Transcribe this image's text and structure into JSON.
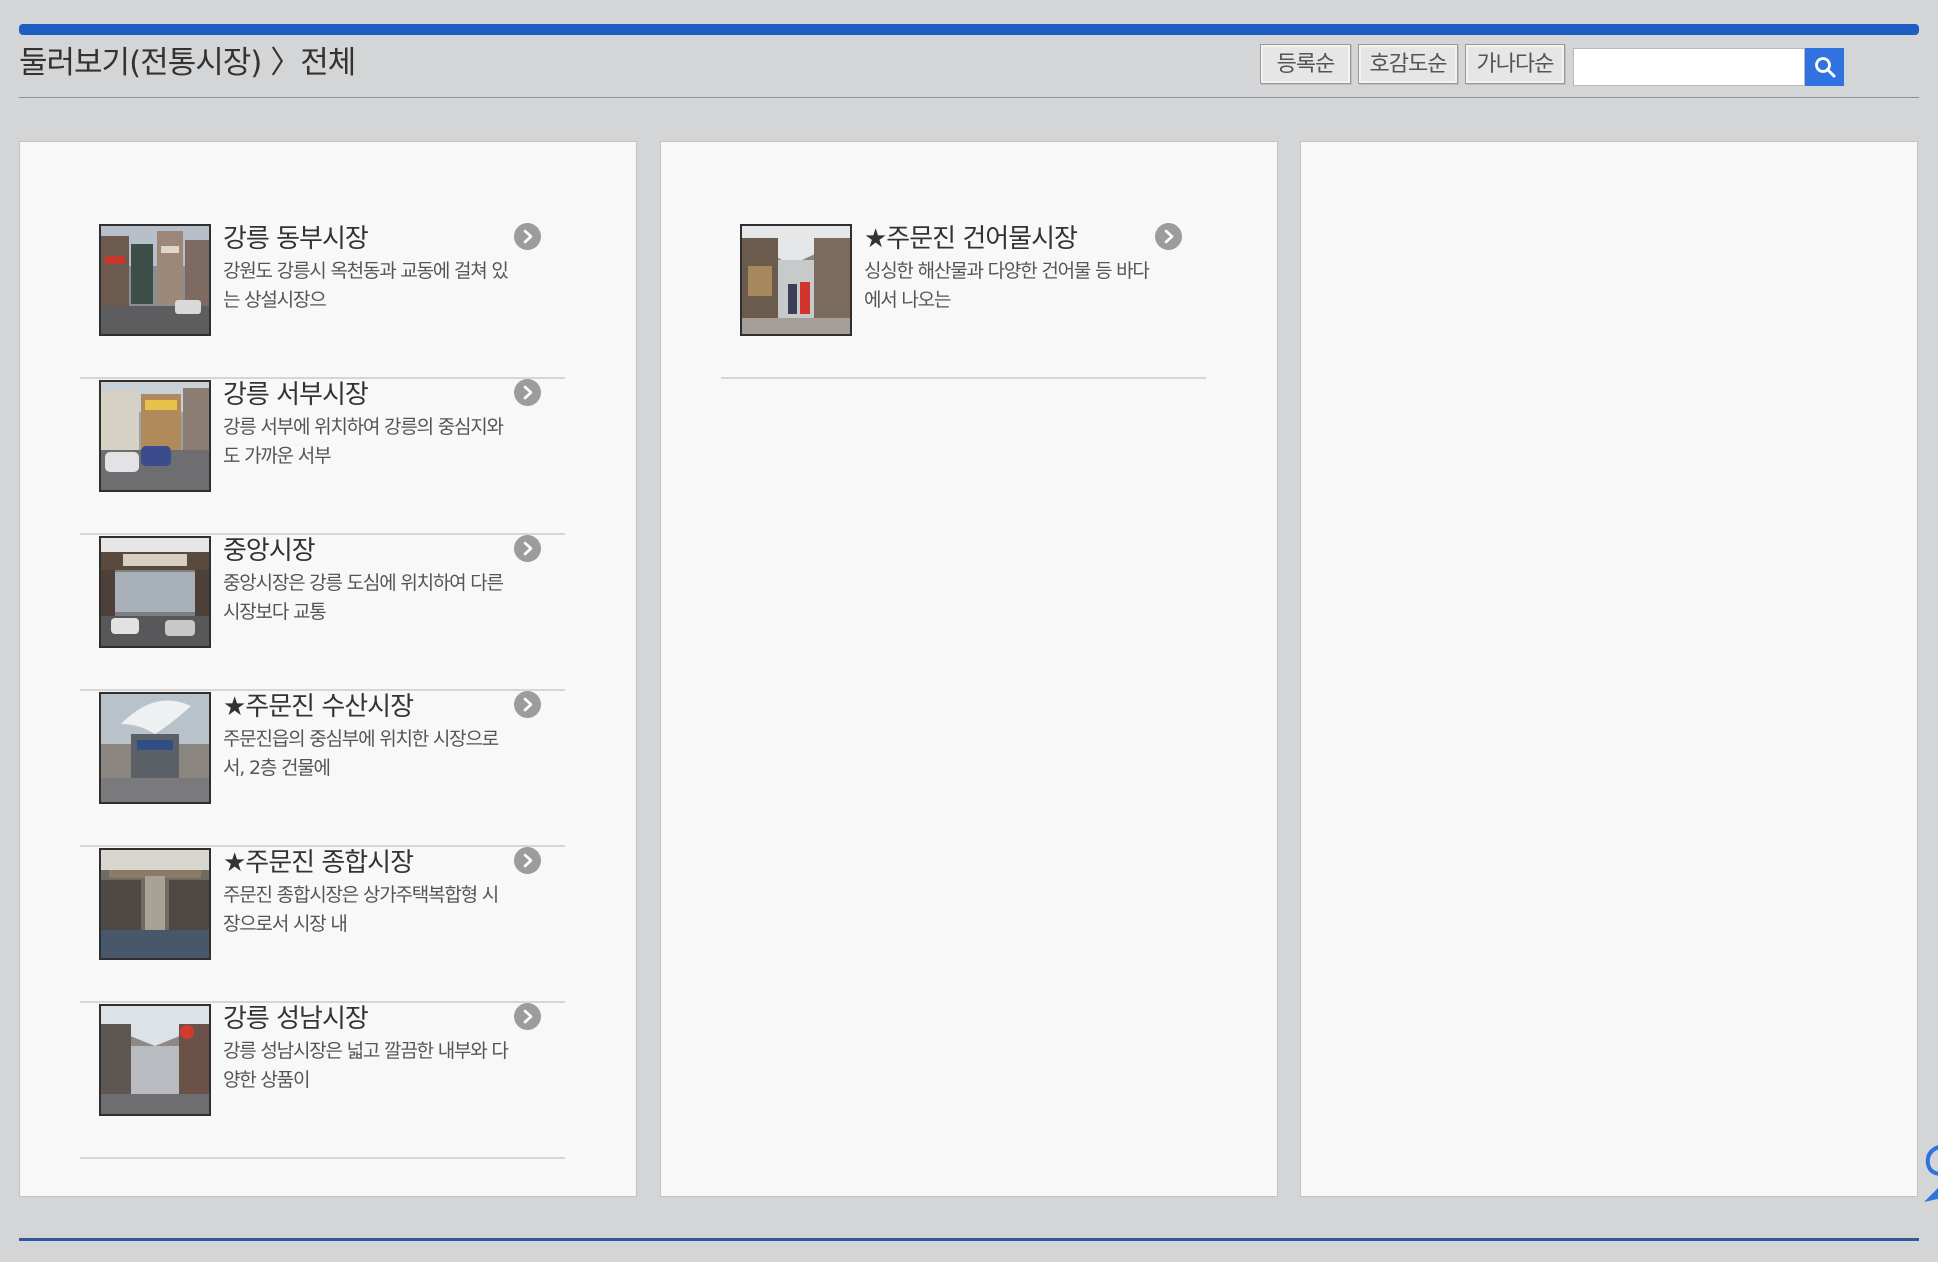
{
  "page": {
    "title": "둘러보기(전통시장) 〉전체"
  },
  "toolbar": {
    "sort_buttons": [
      {
        "label": "등록순"
      },
      {
        "label": "호감도순"
      },
      {
        "label": "가나다순"
      }
    ],
    "search": {
      "value": "",
      "placeholder": ""
    }
  },
  "columns": [
    {
      "items": [
        {
          "title": "강릉 동부시장",
          "desc": "강원도 강릉시 옥천동과 교동에 걸쳐 있는 상설시장으"
        },
        {
          "title": "강릉 서부시장",
          "desc": "강릉 서부에 위치하여 강릉의 중심지와도 가까운 서부"
        },
        {
          "title": "중앙시장",
          "desc": "중앙시장은 강릉 도심에 위치하여 다른 시장보다 교통"
        },
        {
          "title": "★주문진 수산시장",
          "desc": "주문진읍의 중심부에 위치한 시장으로서, 2층 건물에"
        },
        {
          "title": "★주문진 종합시장",
          "desc": "주문진 종합시장은 상가주택복합형 시장으로서 시장 내"
        },
        {
          "title": "강릉 성남시장",
          "desc": "강릉 성남시장은 넓고 깔끔한 내부와 다양한 상품이"
        }
      ]
    },
    {
      "items": [
        {
          "title": "★주문진 건어물시장",
          "desc": "싱싱한 해산물과 다양한 건어물 등 바다에서 나오는"
        }
      ]
    },
    {
      "items": []
    }
  ],
  "colors": {
    "accent": "#1c5ec2",
    "search_button": "#2f72e0",
    "background": "#d4d5d7",
    "panel": "#f8f8f8"
  }
}
